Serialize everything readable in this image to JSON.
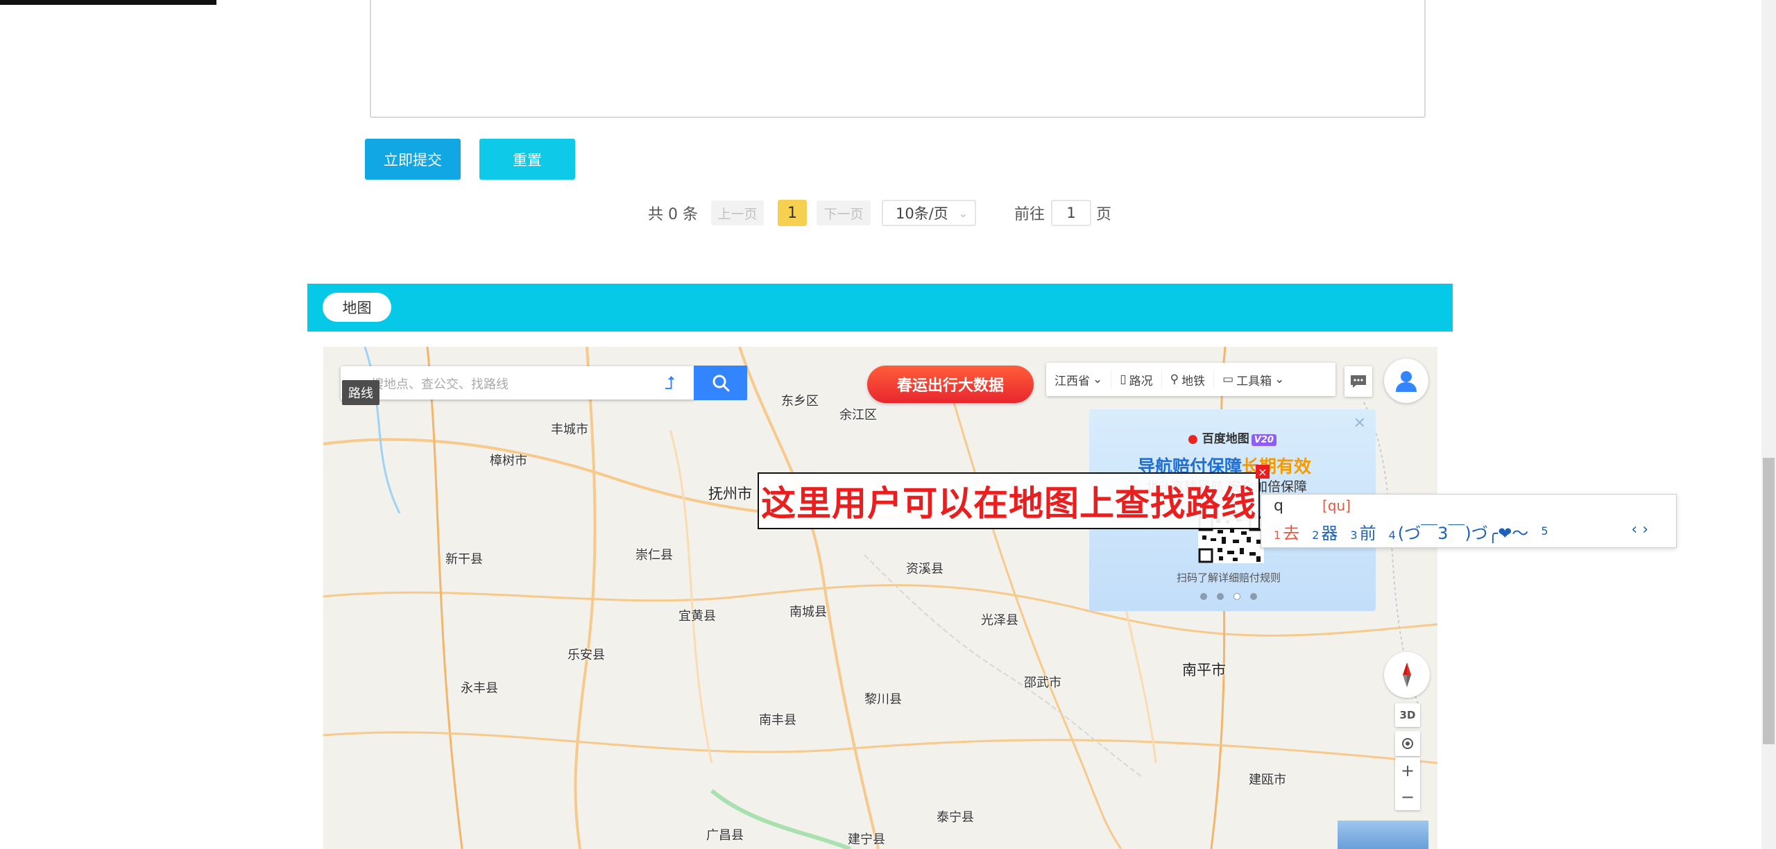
{
  "form": {
    "submit_label": "立即提交",
    "reset_label": "重置"
  },
  "pagination": {
    "total": "共 0 条",
    "prev": "上一页",
    "current": "1",
    "next": "下一页",
    "page_size": "10条/页",
    "goto_label": "前往",
    "goto_value": "1",
    "goto_unit": "页"
  },
  "map_section": {
    "tab_label": "地图"
  },
  "map": {
    "search_placeholder": "搜地点、查公交、找路线",
    "route_tooltip": "路线",
    "promo": "春运出行大数据",
    "toolbar": {
      "province": "江西省",
      "traffic": "路况",
      "subway": "地铁",
      "toolbox": "工具箱"
    },
    "ad": {
      "logo": "百度地图",
      "version": "V20",
      "title_a": "导航赔付保障",
      "title_b": "长期有效",
      "subtitle": "北斗高精导航 安全加倍保障",
      "footer": "扫码了解详细赔付规则"
    },
    "overlay_text": "这里用户可以在地图上查找路线",
    "ime": {
      "typed": "q",
      "pinyin": "[qu]",
      "candidates": [
        {
          "idx": "1",
          "text": "去"
        },
        {
          "idx": "2",
          "text": "器"
        },
        {
          "idx": "3",
          "text": "前"
        },
        {
          "idx": "4",
          "text": "(づ￣3￣)づ╭❤～"
        },
        {
          "idx": "5",
          "text": ""
        }
      ]
    },
    "ctrl_3d": "3D",
    "cities": [
      {
        "name": "东乡区"
      },
      {
        "name": "余江区"
      },
      {
        "name": "丰城市"
      },
      {
        "name": "樟树市"
      },
      {
        "name": "抚州市"
      },
      {
        "name": "崇仁县"
      },
      {
        "name": "新干县"
      },
      {
        "name": "资溪县"
      },
      {
        "name": "宜黄县"
      },
      {
        "name": "南城县"
      },
      {
        "name": "光泽县"
      },
      {
        "name": "乐安县"
      },
      {
        "name": "永丰县"
      },
      {
        "name": "黎川县"
      },
      {
        "name": "邵武市"
      },
      {
        "name": "南平市"
      },
      {
        "name": "南丰县"
      },
      {
        "name": "建瓯市"
      },
      {
        "name": "广昌县"
      },
      {
        "name": "泰宁县"
      },
      {
        "name": "建宁县"
      }
    ]
  }
}
